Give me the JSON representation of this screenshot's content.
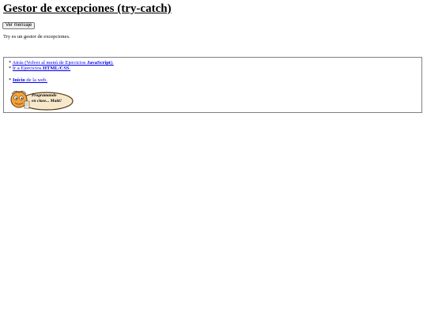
{
  "title": "Gestor de excepciones (try-catch)",
  "button": {
    "label": "Ver mensaje"
  },
  "intro": "Try es un gestor de excepciones.",
  "nav": {
    "back": {
      "prefix": "* ",
      "link_text": "Atrás (Volver al menú de Ejercicios ",
      "link_bold": "JavaScript",
      "link_suffix": ")."
    },
    "html_css": {
      "prefix": "* ",
      "link_text": " Ir a Ejercicios ",
      "link_bold": "HTML/CSS",
      "link_suffix": "."
    },
    "home": {
      "prefix": "* ",
      "link_bold": " Inicio",
      "link_text": " de la web."
    }
  },
  "logo": {
    "line1": "Programando",
    "line2": "en clase... Maiti!",
    "colors": {
      "face": "#f2a23a",
      "oval": "#f7e8cc",
      "outline": "#5a3a12"
    }
  }
}
